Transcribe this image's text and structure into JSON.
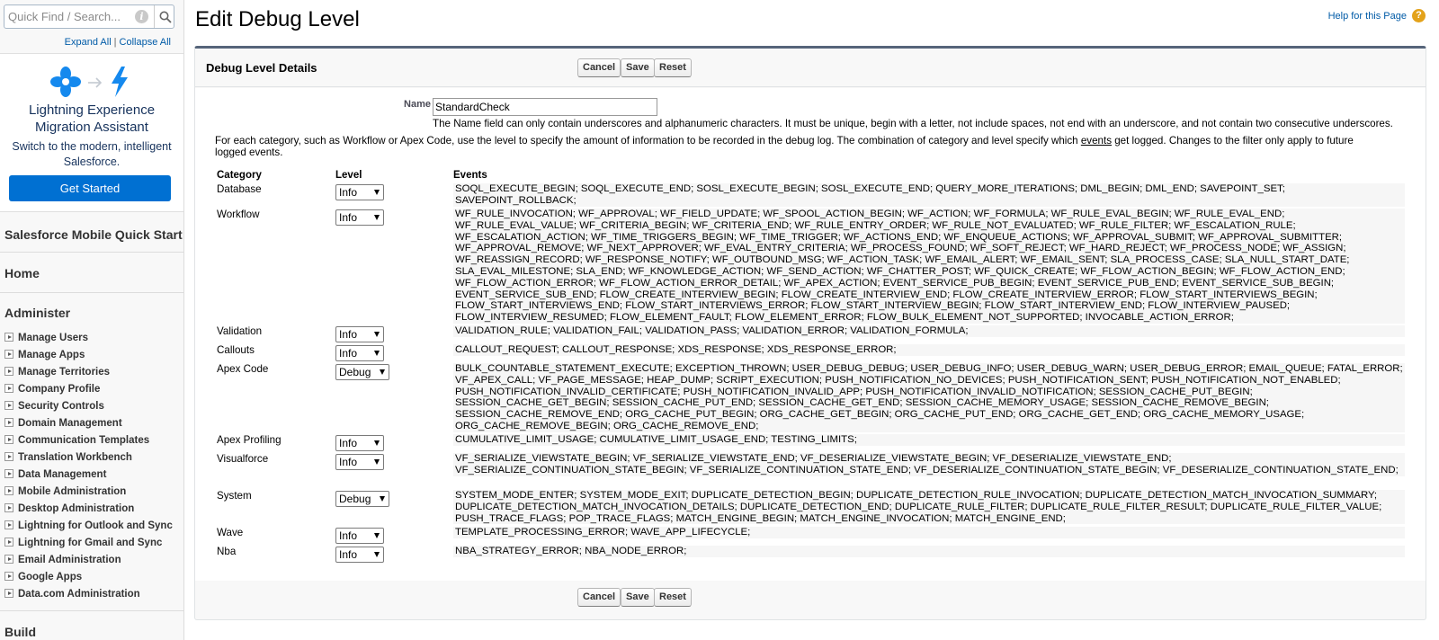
{
  "sidebar": {
    "quick_find_placeholder": "Quick Find / Search...",
    "expand_all": "Expand All",
    "collapse_all": "Collapse All",
    "separator": "|",
    "lma": {
      "title_line1": "Lightning Experience",
      "title_line2": "Migration Assistant",
      "subtitle_line1": "Switch to the modern, intelligent",
      "subtitle_line2": "Salesforce.",
      "button": "Get Started"
    },
    "mobile_quick_start": "Salesforce Mobile Quick Start",
    "home": "Home",
    "administer": "Administer",
    "items": [
      "Manage Users",
      "Manage Apps",
      "Manage Territories",
      "Company Profile",
      "Security Controls",
      "Domain Management",
      "Communication Templates",
      "Translation Workbench",
      "Data Management",
      "Mobile Administration",
      "Desktop Administration",
      "Lightning for Outlook and Sync",
      "Lightning for Gmail and Sync",
      "Email Administration",
      "Google Apps",
      "Data.com Administration"
    ],
    "build": "Build"
  },
  "header": {
    "title": "Edit Debug Level",
    "help_link": "Help for this Page",
    "help_icon": "?"
  },
  "block": {
    "title": "Debug Level Details",
    "buttons": {
      "cancel": "Cancel",
      "save": "Save",
      "reset": "Reset"
    },
    "name_label": "Name",
    "name_value": "StandardCheck",
    "name_help": "The Name field can only contain underscores and alphanumeric characters. It must be unique, begin with a letter, not include spaces, not end with an underscore, and not contain two consecutive underscores.",
    "intro_before": "For each category, such as Workflow or Apex Code, use the level to specify the amount of information to be recorded in the debug log. The combination of category and level specify which ",
    "intro_link": "events",
    "intro_after": " get logged. Changes to the filter only apply to future logged events.",
    "columns": {
      "category": "Category",
      "level": "Level",
      "events": "Events"
    },
    "rows": [
      {
        "category": "Database",
        "level": "Info",
        "events": "SOQL_EXECUTE_BEGIN; SOQL_EXECUTE_END; SOSL_EXECUTE_BEGIN; SOSL_EXECUTE_END; QUERY_MORE_ITERATIONS; DML_BEGIN; DML_END; SAVEPOINT_SET; SAVEPOINT_ROLLBACK;"
      },
      {
        "category": "Workflow",
        "level": "Info",
        "events": "WF_RULE_INVOCATION; WF_APPROVAL; WF_FIELD_UPDATE; WF_SPOOL_ACTION_BEGIN; WF_ACTION; WF_FORMULA; WF_RULE_EVAL_BEGIN; WF_RULE_EVAL_END; WF_RULE_EVAL_VALUE; WF_CRITERIA_BEGIN; WF_CRITERIA_END; WF_RULE_ENTRY_ORDER; WF_RULE_NOT_EVALUATED; WF_RULE_FILTER; WF_ESCALATION_RULE; WF_ESCALATION_ACTION; WF_TIME_TRIGGERS_BEGIN; WF_TIME_TRIGGER; WF_ACTIONS_END; WF_ENQUEUE_ACTIONS; WF_APPROVAL_SUBMIT; WF_APPROVAL_SUBMITTER; WF_APPROVAL_REMOVE; WF_NEXT_APPROVER; WF_EVAL_ENTRY_CRITERIA; WF_PROCESS_FOUND; WF_SOFT_REJECT; WF_HARD_REJECT; WF_PROCESS_NODE; WF_ASSIGN; WF_REASSIGN_RECORD; WF_RESPONSE_NOTIFY; WF_OUTBOUND_MSG; WF_ACTION_TASK; WF_EMAIL_ALERT; WF_EMAIL_SENT; SLA_PROCESS_CASE; SLA_NULL_START_DATE; SLA_EVAL_MILESTONE; SLA_END; WF_KNOWLEDGE_ACTION; WF_SEND_ACTION; WF_CHATTER_POST; WF_QUICK_CREATE; WF_FLOW_ACTION_BEGIN; WF_FLOW_ACTION_END; WF_FLOW_ACTION_ERROR; WF_FLOW_ACTION_ERROR_DETAIL; WF_APEX_ACTION; EVENT_SERVICE_PUB_BEGIN; EVENT_SERVICE_PUB_END; EVENT_SERVICE_SUB_BEGIN; EVENT_SERVICE_SUB_END; FLOW_CREATE_INTERVIEW_BEGIN; FLOW_CREATE_INTERVIEW_END; FLOW_CREATE_INTERVIEW_ERROR; FLOW_START_INTERVIEWS_BEGIN; FLOW_START_INTERVIEWS_END; FLOW_START_INTERVIEWS_ERROR; FLOW_START_INTERVIEW_BEGIN; FLOW_START_INTERVIEW_END; FLOW_INTERVIEW_PAUSED; FLOW_INTERVIEW_RESUMED; FLOW_ELEMENT_FAULT; FLOW_ELEMENT_ERROR; FLOW_BULK_ELEMENT_NOT_SUPPORTED; INVOCABLE_ACTION_ERROR;"
      },
      {
        "category": "Validation",
        "level": "Info",
        "events": "VALIDATION_RULE; VALIDATION_FAIL; VALIDATION_PASS; VALIDATION_ERROR; VALIDATION_FORMULA;"
      },
      {
        "category": "Callouts",
        "level": "Info",
        "events": "CALLOUT_REQUEST; CALLOUT_RESPONSE; XDS_RESPONSE; XDS_RESPONSE_ERROR;"
      },
      {
        "category": "Apex Code",
        "level": "Debug",
        "events": "BULK_COUNTABLE_STATEMENT_EXECUTE; EXCEPTION_THROWN; USER_DEBUG_DEBUG; USER_DEBUG_INFO; USER_DEBUG_WARN; USER_DEBUG_ERROR; EMAIL_QUEUE; FATAL_ERROR; VF_APEX_CALL; VF_PAGE_MESSAGE; HEAP_DUMP; SCRIPT_EXECUTION; PUSH_NOTIFICATION_NO_DEVICES; PUSH_NOTIFICATION_SENT; PUSH_NOTIFICATION_NOT_ENABLED; PUSH_NOTIFICATION_INVALID_CERTIFICATE; PUSH_NOTIFICATION_INVALID_APP; PUSH_NOTIFICATION_INVALID_NOTIFICATION; SESSION_CACHE_PUT_BEGIN; SESSION_CACHE_GET_BEGIN; SESSION_CACHE_PUT_END; SESSION_CACHE_GET_END; SESSION_CACHE_MEMORY_USAGE; SESSION_CACHE_REMOVE_BEGIN; SESSION_CACHE_REMOVE_END; ORG_CACHE_PUT_BEGIN; ORG_CACHE_GET_BEGIN; ORG_CACHE_PUT_END; ORG_CACHE_GET_END; ORG_CACHE_MEMORY_USAGE; ORG_CACHE_REMOVE_BEGIN; ORG_CACHE_REMOVE_END;"
      },
      {
        "category": "Apex Profiling",
        "level": "Info",
        "events": "CUMULATIVE_LIMIT_USAGE; CUMULATIVE_LIMIT_USAGE_END; TESTING_LIMITS;"
      },
      {
        "category": "Visualforce",
        "level": "Info",
        "events": "VF_SERIALIZE_VIEWSTATE_BEGIN; VF_SERIALIZE_VIEWSTATE_END; VF_DESERIALIZE_VIEWSTATE_BEGIN; VF_DESERIALIZE_VIEWSTATE_END; VF_SERIALIZE_CONTINUATION_STATE_BEGIN; VF_SERIALIZE_CONTINUATION_STATE_END; VF_DESERIALIZE_CONTINUATION_STATE_BEGIN; VF_DESERIALIZE_CONTINUATION_STATE_END;"
      },
      {
        "category": "System",
        "level": "Debug",
        "events": "SYSTEM_MODE_ENTER; SYSTEM_MODE_EXIT; DUPLICATE_DETECTION_BEGIN; DUPLICATE_DETECTION_RULE_INVOCATION; DUPLICATE_DETECTION_MATCH_INVOCATION_SUMMARY; DUPLICATE_DETECTION_MATCH_INVOCATION_DETAILS; DUPLICATE_DETECTION_END; DUPLICATE_RULE_FILTER; DUPLICATE_RULE_FILTER_RESULT; DUPLICATE_RULE_FILTER_VALUE; PUSH_TRACE_FLAGS; POP_TRACE_FLAGS; MATCH_ENGINE_BEGIN; MATCH_ENGINE_INVOCATION; MATCH_ENGINE_END;"
      },
      {
        "category": "Wave",
        "level": "Info",
        "events": "TEMPLATE_PROCESSING_ERROR; WAVE_APP_LIFECYCLE;"
      },
      {
        "category": "Nba",
        "level": "Info",
        "events": "NBA_STRATEGY_ERROR; NBA_NODE_ERROR;"
      }
    ]
  }
}
